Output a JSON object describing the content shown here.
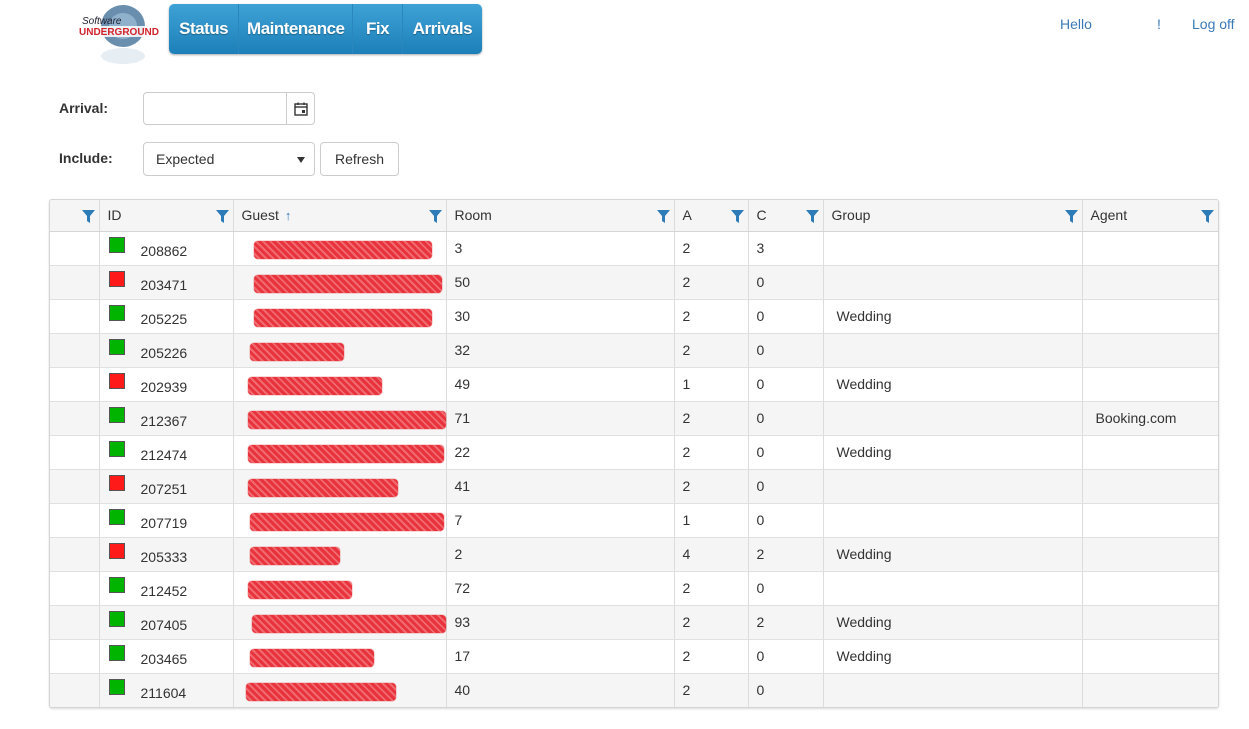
{
  "logo": {
    "alt_text": "Software Underground"
  },
  "nav": [
    {
      "label": "Status"
    },
    {
      "label": "Maintenance"
    },
    {
      "label": "Fix"
    },
    {
      "label": "Arrivals"
    }
  ],
  "header_links": {
    "hello": "Hello",
    "bang": "!",
    "logoff": "Log off"
  },
  "filters": {
    "arrival_label": "Arrival:",
    "arrival_value": "",
    "include_label": "Include:",
    "include_value": "Expected",
    "refresh_label": "Refresh"
  },
  "columns": [
    "",
    "ID",
    "Guest",
    "Room",
    "A",
    "C",
    "Group",
    "Agent"
  ],
  "rows": [
    {
      "status": "green",
      "id": "208862",
      "room": "3",
      "a": "2",
      "c": "3",
      "group": "",
      "agent": ""
    },
    {
      "status": "red",
      "id": "203471",
      "room": "50",
      "a": "2",
      "c": "0",
      "group": "",
      "agent": ""
    },
    {
      "status": "green",
      "id": "205225",
      "room": "30",
      "a": "2",
      "c": "0",
      "group": "Wedding",
      "agent": ""
    },
    {
      "status": "green",
      "id": "205226",
      "room": "32",
      "a": "2",
      "c": "0",
      "group": "",
      "agent": ""
    },
    {
      "status": "red",
      "id": "202939",
      "room": "49",
      "a": "1",
      "c": "0",
      "group": "Wedding",
      "agent": ""
    },
    {
      "status": "green",
      "id": "212367",
      "room": "71",
      "a": "2",
      "c": "0",
      "group": "",
      "agent": "Booking.com"
    },
    {
      "status": "green",
      "id": "212474",
      "room": "22",
      "a": "2",
      "c": "0",
      "group": "Wedding",
      "agent": ""
    },
    {
      "status": "red",
      "id": "207251",
      "room": "41",
      "a": "2",
      "c": "0",
      "group": "",
      "agent": ""
    },
    {
      "status": "green",
      "id": "207719",
      "room": "7",
      "a": "1",
      "c": "0",
      "group": "",
      "agent": ""
    },
    {
      "status": "red",
      "id": "205333",
      "room": "2",
      "a": "4",
      "c": "2",
      "group": "Wedding",
      "agent": ""
    },
    {
      "status": "green",
      "id": "212452",
      "room": "72",
      "a": "2",
      "c": "0",
      "group": "",
      "agent": ""
    },
    {
      "status": "green",
      "id": "207405",
      "room": "93",
      "a": "2",
      "c": "2",
      "group": "Wedding",
      "agent": ""
    },
    {
      "status": "green",
      "id": "203465",
      "room": "17",
      "a": "2",
      "c": "0",
      "group": "Wedding",
      "agent": ""
    },
    {
      "status": "green",
      "id": "211604",
      "room": "40",
      "a": "2",
      "c": "0",
      "group": "",
      "agent": ""
    }
  ],
  "colors": {
    "status_green": "#00b400",
    "status_red": "#ff1a1a",
    "nav_blue": "#2a8cc6",
    "link_blue": "#3a79b8"
  }
}
